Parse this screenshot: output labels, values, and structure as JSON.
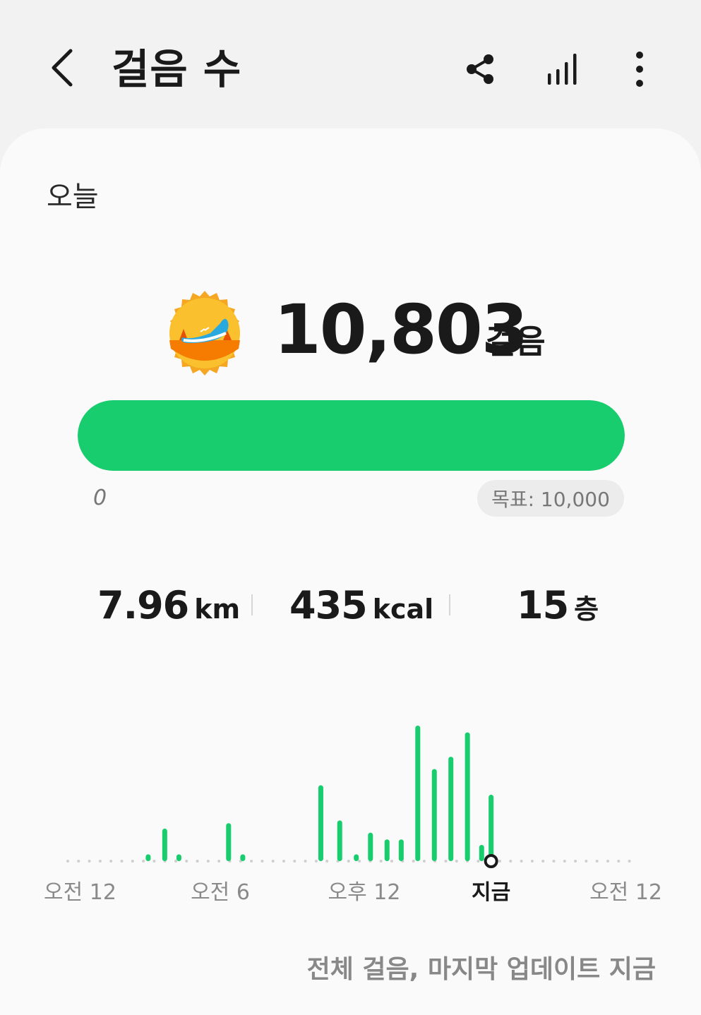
{
  "header": {
    "title": "걸음 수",
    "back_icon": "back-chevron-icon",
    "actions": [
      "share-icon",
      "bar-chart-icon",
      "more-vertical-icon"
    ]
  },
  "period": "오늘",
  "steps": {
    "count": "10,803",
    "unit": "걸음",
    "badge_icon": "goal-achieved-shoe-badge-icon",
    "progress_fraction": 1.0,
    "progress_min_label": "0",
    "goal_label": "목표: 10,000"
  },
  "metrics": {
    "distance": {
      "value": "7.96",
      "unit": "km"
    },
    "calories": {
      "value": "435",
      "unit": "kcal"
    },
    "floors": {
      "value": "15",
      "unit": "층"
    }
  },
  "colors": {
    "accent": "#17cd6d",
    "badge_orange": "#f5a623"
  },
  "chart_data": {
    "type": "bar",
    "x_labels": [
      "오전 12",
      "오전 6",
      "오후 12",
      "지금",
      "오전 12"
    ],
    "current_label": "지금",
    "bar_heights_relative": [
      0.05,
      0.24,
      0.05,
      0.28,
      0.05,
      0.56,
      0.3,
      0.05,
      0.21,
      0.16,
      0.16,
      1.0,
      0.68,
      0.77,
      0.95,
      0.12,
      0.49
    ],
    "bar_hour_positions": [
      3.4,
      4.1,
      4.7,
      6.8,
      7.4,
      10.7,
      11.5,
      12.2,
      12.8,
      13.5,
      14.1,
      14.8,
      15.5,
      16.2,
      16.9,
      17.5,
      17.9
    ],
    "current_hour": 17.9,
    "hours_range": [
      0,
      24
    ]
  },
  "footnote": "전체 걸음, 마지막 업데이트 지금"
}
